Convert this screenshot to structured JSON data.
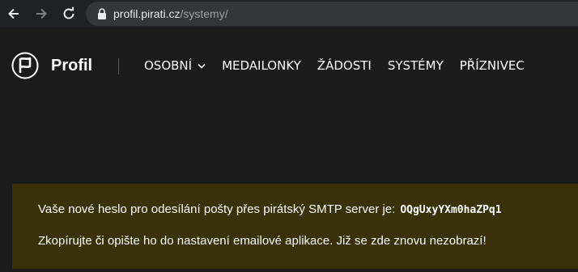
{
  "browser": {
    "url_host": "profil.pirati.cz",
    "url_path": "/systemy/"
  },
  "header": {
    "brand": "Profil",
    "nav": [
      {
        "label": "Osobní",
        "has_dropdown": true
      },
      {
        "label": "Medailonky"
      },
      {
        "label": "Žádosti"
      },
      {
        "label": "Systémy"
      },
      {
        "label": "Příznivec"
      }
    ]
  },
  "alert": {
    "line1_text": "Vaše nové heslo pro odesílání pošty přes pirátský SMTP server je:",
    "password": "OQgUxyYXm0haZPq1",
    "line2_text": "Zkopírujte či opište ho do nastavení emailové aplikace. Již se zde znovu nezobrazí!"
  },
  "colors": {
    "background": "#1b1b1b",
    "alert_bg": "#3a3108",
    "text": "#ffffff"
  }
}
